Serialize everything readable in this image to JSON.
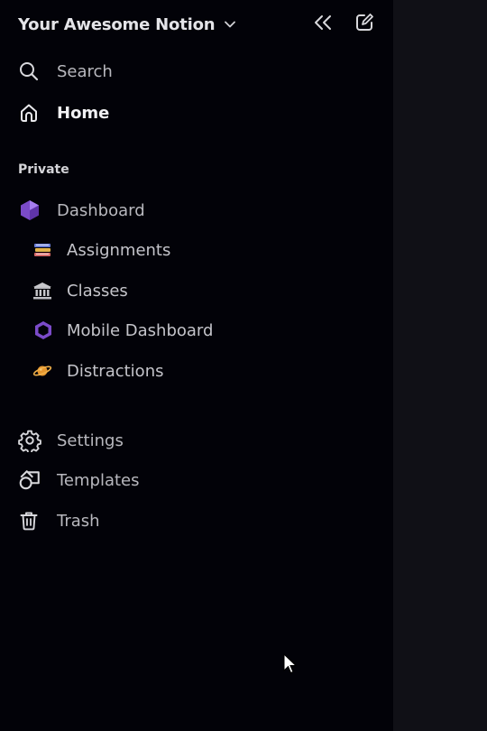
{
  "workspace": {
    "title": "Your Awesome Notion"
  },
  "top_nav": {
    "search": "Search",
    "home": "Home"
  },
  "section": {
    "private": "Private"
  },
  "pages": {
    "dashboard": "Dashboard",
    "assignments": "Assignments",
    "classes": "Classes",
    "mobile_dashboard": "Mobile Dashboard",
    "distractions": "Distractions"
  },
  "bottom_nav": {
    "settings": "Settings",
    "templates": "Templates",
    "trash": "Trash"
  },
  "colors": {
    "sidebar_bg": "#020208",
    "main_bg": "#101016",
    "accent_purple": "#8a58d8"
  },
  "icons": {
    "header": [
      "chevron-down-icon",
      "collapse-sidebar-icon",
      "new-page-icon"
    ],
    "nav": [
      "search-icon",
      "home-icon",
      "gear-icon",
      "templates-icon",
      "trash-icon"
    ],
    "pages": [
      "hexagon-icon",
      "books-icon",
      "building-icon",
      "hexagon-outline-icon",
      "planet-icon"
    ]
  }
}
